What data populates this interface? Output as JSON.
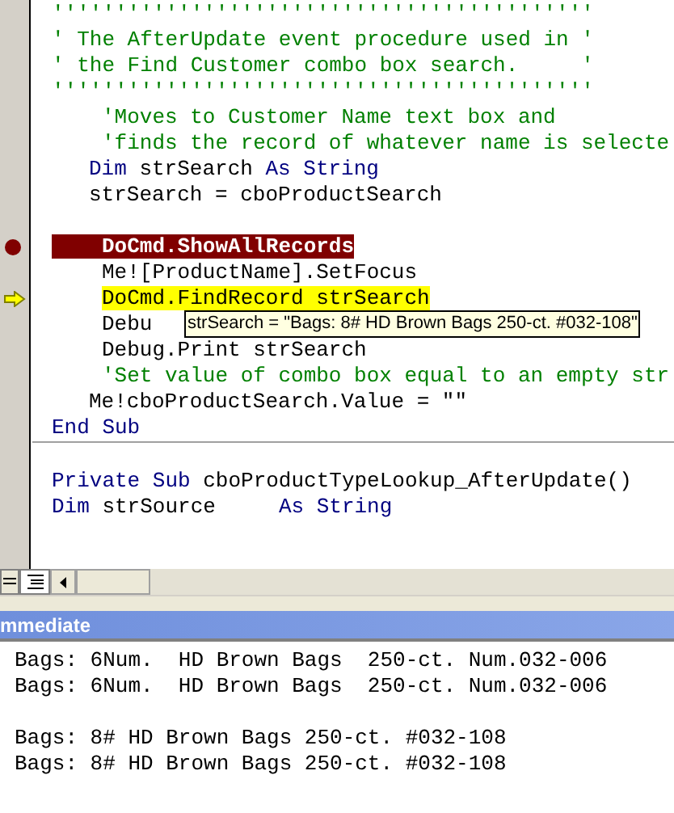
{
  "code_lines": [
    {
      "kind": "code",
      "breakpoint": false,
      "current": false,
      "segments": [
        {
          "text": "'''''''''''''''''''''''''''''''''''''''''''",
          "kind": "comment"
        }
      ]
    },
    {
      "kind": "code",
      "breakpoint": false,
      "current": false,
      "segments": [
        {
          "text": "' The AfterUpdate event procedure used in '",
          "kind": "comment"
        }
      ]
    },
    {
      "kind": "code",
      "breakpoint": false,
      "current": false,
      "segments": [
        {
          "text": "' the Find Customer combo box search.     '",
          "kind": "comment"
        }
      ]
    },
    {
      "kind": "code",
      "breakpoint": false,
      "current": false,
      "segments": [
        {
          "text": "'''''''''''''''''''''''''''''''''''''''''''",
          "kind": "comment"
        }
      ]
    },
    {
      "kind": "statement",
      "breakpoint": false,
      "current": false,
      "segments": [
        {
          "text": "'Moves to Customer Name text box and",
          "kind": "comment"
        }
      ]
    },
    {
      "kind": "statement",
      "breakpoint": false,
      "current": false,
      "segments": [
        {
          "text": "'finds the record of whatever name is selecte",
          "kind": "comment"
        }
      ]
    },
    {
      "kind": "declaration",
      "breakpoint": false,
      "current": false,
      "segments": [
        {
          "text": "Dim",
          "kind": "keyword"
        },
        {
          "text": " strSearch ",
          "kind": "plain"
        },
        {
          "text": "As String",
          "kind": "keyword"
        }
      ]
    },
    {
      "kind": "declaration",
      "breakpoint": false,
      "current": false,
      "segments": [
        {
          "text": "strSearch = cboProductSearch",
          "kind": "plain"
        }
      ]
    },
    {
      "kind": "blank"
    },
    {
      "kind": "statement",
      "breakpoint": true,
      "current": false,
      "segments": [
        {
          "text": "DoCmd.ShowAllRecords",
          "kind": "plain"
        }
      ]
    },
    {
      "kind": "statement",
      "breakpoint": false,
      "current": false,
      "segments": [
        {
          "text": "Me![ProductName].SetFocus",
          "kind": "plain"
        }
      ]
    },
    {
      "kind": "statement",
      "breakpoint": false,
      "current": true,
      "segments": [
        {
          "text": "DoCmd.FindRecord strSearch",
          "kind": "plain"
        }
      ]
    },
    {
      "kind": "statement",
      "breakpoint": false,
      "current": false,
      "tip": "strSearch = \"Bags: 8# HD Brown Bags 250-ct. #032-108\"",
      "segments": [
        {
          "text": "Debu",
          "kind": "plain"
        }
      ]
    },
    {
      "kind": "statement",
      "breakpoint": false,
      "current": false,
      "segments": [
        {
          "text": "Debug.Print strSearch",
          "kind": "plain"
        }
      ]
    },
    {
      "kind": "statement",
      "breakpoint": false,
      "current": false,
      "segments": [
        {
          "text": "'Set value of combo box equal to an empty str",
          "kind": "comment"
        }
      ]
    },
    {
      "kind": "declaration",
      "breakpoint": false,
      "current": false,
      "segments": [
        {
          "text": "Me!cboProductSearch.Value = \"\"",
          "kind": "plain"
        }
      ]
    },
    {
      "kind": "code",
      "breakpoint": false,
      "current": false,
      "segments": [
        {
          "text": "End Sub",
          "kind": "keyword"
        }
      ]
    },
    {
      "kind": "divider"
    },
    {
      "kind": "blank"
    },
    {
      "kind": "code",
      "breakpoint": false,
      "current": false,
      "segments": [
        {
          "text": "Private Sub",
          "kind": "keyword"
        },
        {
          "text": " cboProductTypeLookup_AfterUpdate()",
          "kind": "plain"
        }
      ]
    },
    {
      "kind": "code",
      "breakpoint": false,
      "current": false,
      "segments": [
        {
          "text": "Dim",
          "kind": "keyword"
        },
        {
          "text": " strSource     ",
          "kind": "plain"
        },
        {
          "text": "As String",
          "kind": "keyword"
        }
      ]
    }
  ],
  "immediate": {
    "title": "mmediate",
    "lines": [
      {
        "kind": "text",
        "text": "Bags: 6Num.  HD Brown Bags  250-ct. Num.032-006"
      },
      {
        "kind": "text",
        "text": "Bags: 6Num.  HD Brown Bags  250-ct. Num.032-006"
      },
      {
        "kind": "blank"
      },
      {
        "kind": "text",
        "text": "Bags: 8# HD Brown Bags 250-ct. #032-108"
      },
      {
        "kind": "text",
        "text": "Bags: 8# HD Brown Bags 250-ct. #032-108"
      }
    ]
  }
}
